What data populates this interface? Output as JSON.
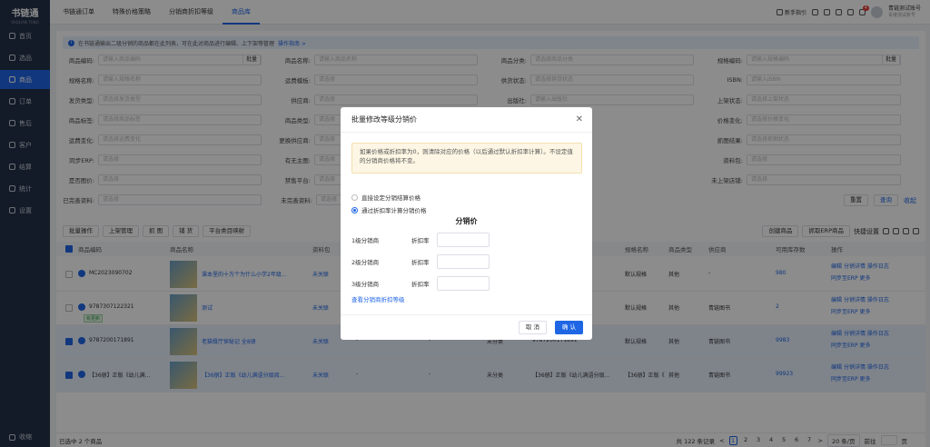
{
  "brand": {
    "name": "书链通",
    "sub": "SHULIAN TONG"
  },
  "sidebar": {
    "items": [
      {
        "label": "首页"
      },
      {
        "label": "选品"
      },
      {
        "label": "商品"
      },
      {
        "label": "订单"
      },
      {
        "label": "售后"
      },
      {
        "label": "客户"
      },
      {
        "label": "结算"
      },
      {
        "label": "统计"
      },
      {
        "label": "设置"
      }
    ],
    "active_index": 2,
    "collapse": "收缩"
  },
  "tabs": [
    {
      "label": "书链通订单"
    },
    {
      "label": "特殊价格策略"
    },
    {
      "label": "分销商折扣等级"
    },
    {
      "label": "商品库"
    }
  ],
  "active_tab": 3,
  "topbar": {
    "guide": "新手指引",
    "badge": "4",
    "user": "青链测试账号",
    "user_sub": "青链测试账号"
  },
  "notice": {
    "text": "在书链通输出二级分销的商品都在此列表，可在此对商品进行编辑、上下架等管理",
    "link": "操作指南 >"
  },
  "filters": [
    {
      "label": "商品编码:",
      "ph": "请输入商品编码",
      "btn": "批量"
    },
    {
      "label": "商品名称:",
      "ph": "请输入商品名称"
    },
    {
      "label": "商品分类:",
      "ph": "请选择商品分类"
    },
    {
      "label": "规格编码:",
      "ph": "请输入规格编码",
      "btn": "批量"
    },
    {
      "label": "规格名称:",
      "ph": "请输入规格名称"
    },
    {
      "label": "运费模板:",
      "ph": "请选择"
    },
    {
      "label": "供货状态:",
      "ph": "请选择供货状态"
    },
    {
      "label": "ISBN:",
      "ph": "请输入ISBN"
    },
    {
      "label": "发货类型:",
      "ph": "请选择发货类型"
    },
    {
      "label": "供应商:",
      "ph": "请选择"
    },
    {
      "label": "出版社:",
      "ph": "请输入出版社"
    },
    {
      "label": "上架状态:",
      "ph": "请选择上架状态"
    },
    {
      "label": "商品标签:",
      "ph": "请选择商品标签"
    },
    {
      "label": "商品类型:",
      "ph": "请选择"
    },
    {
      "label": "",
      "ph": ""
    },
    {
      "label": "价格变化:",
      "ph": "请选择价格变化"
    },
    {
      "label": "运费变化:",
      "ph": "请选择运费变化"
    },
    {
      "label": "更换供应商:",
      "ph": "请选择"
    },
    {
      "label": "",
      "ph": ""
    },
    {
      "label": "抓图结果:",
      "ph": "请选择抓图状态"
    },
    {
      "label": "同步ERP:",
      "ph": "请选择"
    },
    {
      "label": "有无主图:",
      "ph": "请选择"
    },
    {
      "label": "",
      "ph": ""
    },
    {
      "label": "资料包:",
      "ph": "请选择"
    },
    {
      "label": "是否图价:",
      "ph": "请选择"
    },
    {
      "label": "禁售平台:",
      "ph": "请选择"
    },
    {
      "label": "",
      "ph": ""
    },
    {
      "label": "未上架店铺:",
      "ph": "请选择"
    }
  ],
  "filter_row8": {
    "a_label": "已完善资料:",
    "a_ph": "请选择",
    "b_label": "未完善资料:",
    "b_ph": "请选择",
    "reset": "重置",
    "search": "查询",
    "collapse": "收起"
  },
  "toolbar": {
    "batch": "批量操作",
    "shelf": "上架管理",
    "grab": "抓 图",
    "replenish": "铺 货",
    "platform": "平台类目映射",
    "create": "创建商品",
    "grab_erp": "抓取ERP商品",
    "quick": "快捷设置"
  },
  "table": {
    "headers": [
      "商品编码",
      "商品名称",
      "资料包",
      "规格名称",
      "商品类型",
      "供应商",
      "可用库存数",
      "操作"
    ]
  },
  "rows": [
    {
      "code": "MC2023090702",
      "name": "课本里的十万个为什么小学2年级...",
      "pack": "未关联",
      "spec": "默认规格",
      "type": "其他",
      "supplier": "-",
      "stock": "980",
      "checked": false,
      "tag": ""
    },
    {
      "code": "9787307122321",
      "name": "测试",
      "pack": "未关联",
      "spec": "默认规格",
      "type": "其他",
      "supplier": "青链图书",
      "stock": "2",
      "checked": false,
      "tag": "有更新"
    },
    {
      "code": "9787200171891",
      "name": "老猫餐厅探秘记 全8册",
      "pack": "未关联",
      "dash1": "-",
      "dash2": "-",
      "cat": "未分类",
      "isbn": "9787200171891",
      "spec": "默认规格",
      "type": "其他",
      "supplier": "青链图书",
      "stock": "9983",
      "checked": true,
      "tag": ""
    },
    {
      "code": "【36册】正版《幼儿满...",
      "name": "【36册】正版《幼儿满语分级阅...",
      "pack": "未关联",
      "dash1": "-",
      "dash2": "-",
      "cat": "未分类",
      "isbn": "【36册】正版《幼儿满语分级...",
      "spec": "【36册】正版《幼儿满语分...",
      "type": "其他",
      "supplier": "青链图书",
      "stock": "99923",
      "checked": true,
      "tag": ""
    }
  ],
  "ops": {
    "edit": "编辑",
    "dist_price": "分销详情",
    "log": "操作日志",
    "sync": "同步至ERP",
    "more": "更多"
  },
  "footer": {
    "selected": "已选中 2 个商品",
    "total": "共 122 条记录",
    "pages": [
      "1",
      "2",
      "3",
      "4",
      "5",
      "6",
      "7"
    ],
    "page_size": "20 条/页",
    "goto": "前往",
    "page_suffix": "页",
    "prev": "<",
    "next": ">"
  },
  "modal": {
    "title": "批量修改等级分销价",
    "warning": "如果价格或折扣率为0，则清除对应的价格（以后通过默认折扣率计算）。不设定值的分销商价格将不变。",
    "option_direct": "直接设定分销结算价格",
    "option_discount": "通过折扣率计算分销价格",
    "section": "分销价",
    "levels": [
      {
        "name": "1级分销商",
        "field": "折扣率"
      },
      {
        "name": "2级分销商",
        "field": "折扣率"
      },
      {
        "name": "3级分销商",
        "field": "折扣率"
      }
    ],
    "link": "查看分销商折扣等级",
    "cancel": "取 消",
    "ok": "确 认"
  }
}
